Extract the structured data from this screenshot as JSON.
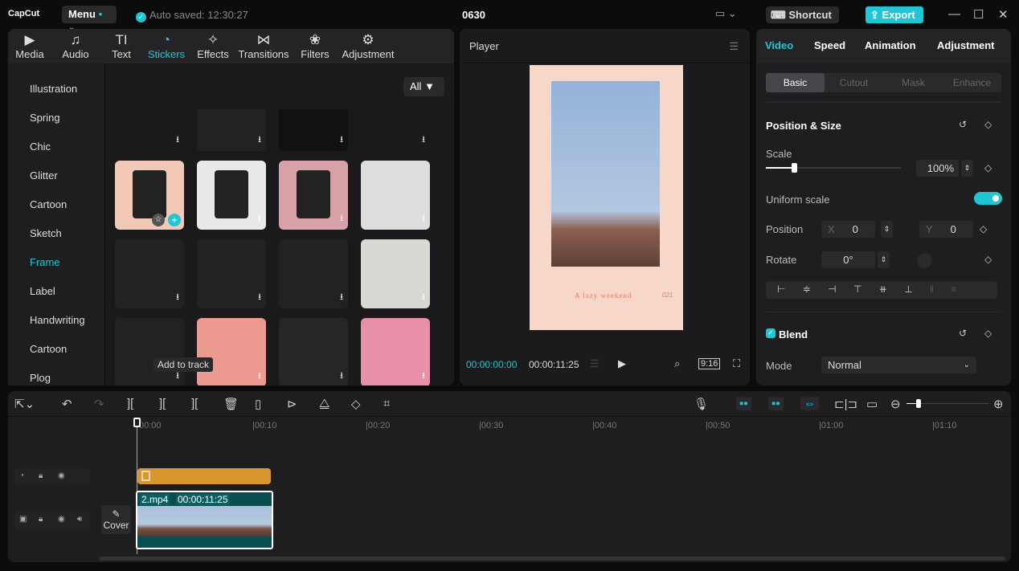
{
  "app": {
    "logo": "CapCut",
    "menu": "Menu",
    "autosave": "Auto saved: 12:30:27",
    "project_title": "0630",
    "shortcut": "Shortcut",
    "export": "Export",
    "accent": "#1fc7d4"
  },
  "tabs": [
    {
      "label": "Media",
      "icon": "▶"
    },
    {
      "label": "Audio",
      "icon": "♫"
    },
    {
      "label": "Text",
      "icon": "TI"
    },
    {
      "label": "Stickers",
      "icon": "◔"
    },
    {
      "label": "Effects",
      "icon": "✧"
    },
    {
      "label": "Transitions",
      "icon": "⋈"
    },
    {
      "label": "Filters",
      "icon": "❀"
    },
    {
      "label": "Adjustment",
      "icon": "⚙"
    }
  ],
  "categories": [
    "Illustration",
    "Spring",
    "Chic",
    "Glitter",
    "Cartoon",
    "Sketch",
    "Frame",
    "Label",
    "Handwriting",
    "Cartoon",
    "Plog"
  ],
  "active_category": "Frame",
  "filter": {
    "label": "All"
  },
  "tooltip": "Add to track",
  "player": {
    "title": "Player",
    "current_time": "00:00:00:00",
    "total_time": "00:00:11:25",
    "ratio": "9:16",
    "caption": "A lazy weekend",
    "caption_num": "021"
  },
  "properties": {
    "tabs": [
      "Video",
      "Speed",
      "Animation",
      "Adjustment"
    ],
    "subtabs": [
      "Basic",
      "Cutout",
      "Mask",
      "Enhance"
    ],
    "section": "Position & Size",
    "scale_label": "Scale",
    "scale_value": "100%",
    "scale_fraction": 0.25,
    "uniform_label": "Uniform scale",
    "uniform_on": true,
    "position_label": "Position",
    "x_label": "X",
    "x_value": "0",
    "y_label": "Y",
    "y_value": "0",
    "rotate_label": "Rotate",
    "rotate_value": "0°",
    "blend_label": "Blend",
    "mode_label": "Mode",
    "mode_value": "Normal"
  },
  "timeline": {
    "ticks": [
      "00:00",
      "|00:10",
      "|00:20",
      "|00:30",
      "|00:40",
      "|00:50",
      "|01:00",
      "|01:10"
    ],
    "clip_name": "2.mp4",
    "clip_duration": "00:00:11:25",
    "cover": "Cover"
  }
}
